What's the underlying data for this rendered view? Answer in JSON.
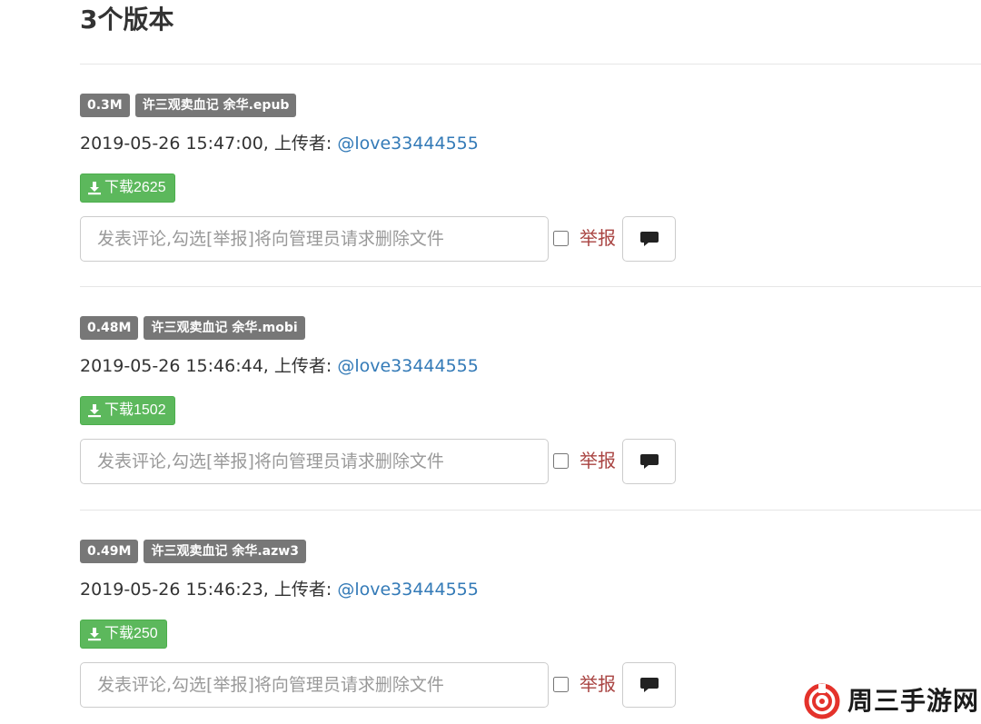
{
  "header": {
    "title": "3个版本"
  },
  "versions": [
    {
      "size": "0.3M",
      "filename": "许三观卖血记 余华.epub",
      "timestamp": "2019-05-26 15:47:00, 上传者: ",
      "uploader": "@love33444555",
      "download_label": "下载2625",
      "comment_placeholder": "发表评论,勾选[举报]将向管理员请求删除文件",
      "report_label": "举报"
    },
    {
      "size": "0.48M",
      "filename": "许三观卖血记 余华.mobi",
      "timestamp": "2019-05-26 15:46:44, 上传者: ",
      "uploader": "@love33444555",
      "download_label": "下载1502",
      "comment_placeholder": "发表评论,勾选[举报]将向管理员请求删除文件",
      "report_label": "举报"
    },
    {
      "size": "0.49M",
      "filename": "许三观卖血记 余华.azw3",
      "timestamp": "2019-05-26 15:46:23, 上传者: ",
      "uploader": "@love33444555",
      "download_label": "下载250",
      "comment_placeholder": "发表评论,勾选[举报]将向管理员请求删除文件",
      "report_label": "举报"
    }
  ],
  "watermark": {
    "text": "周三手游网"
  },
  "icons": {
    "download": "download-icon",
    "comment": "comment-icon",
    "logo": "spiral-logo-icon"
  },
  "colors": {
    "badge": "#777777",
    "link": "#337ab7",
    "download": "#5cb85c",
    "report": "#a94442",
    "logo": "#e4322b"
  }
}
